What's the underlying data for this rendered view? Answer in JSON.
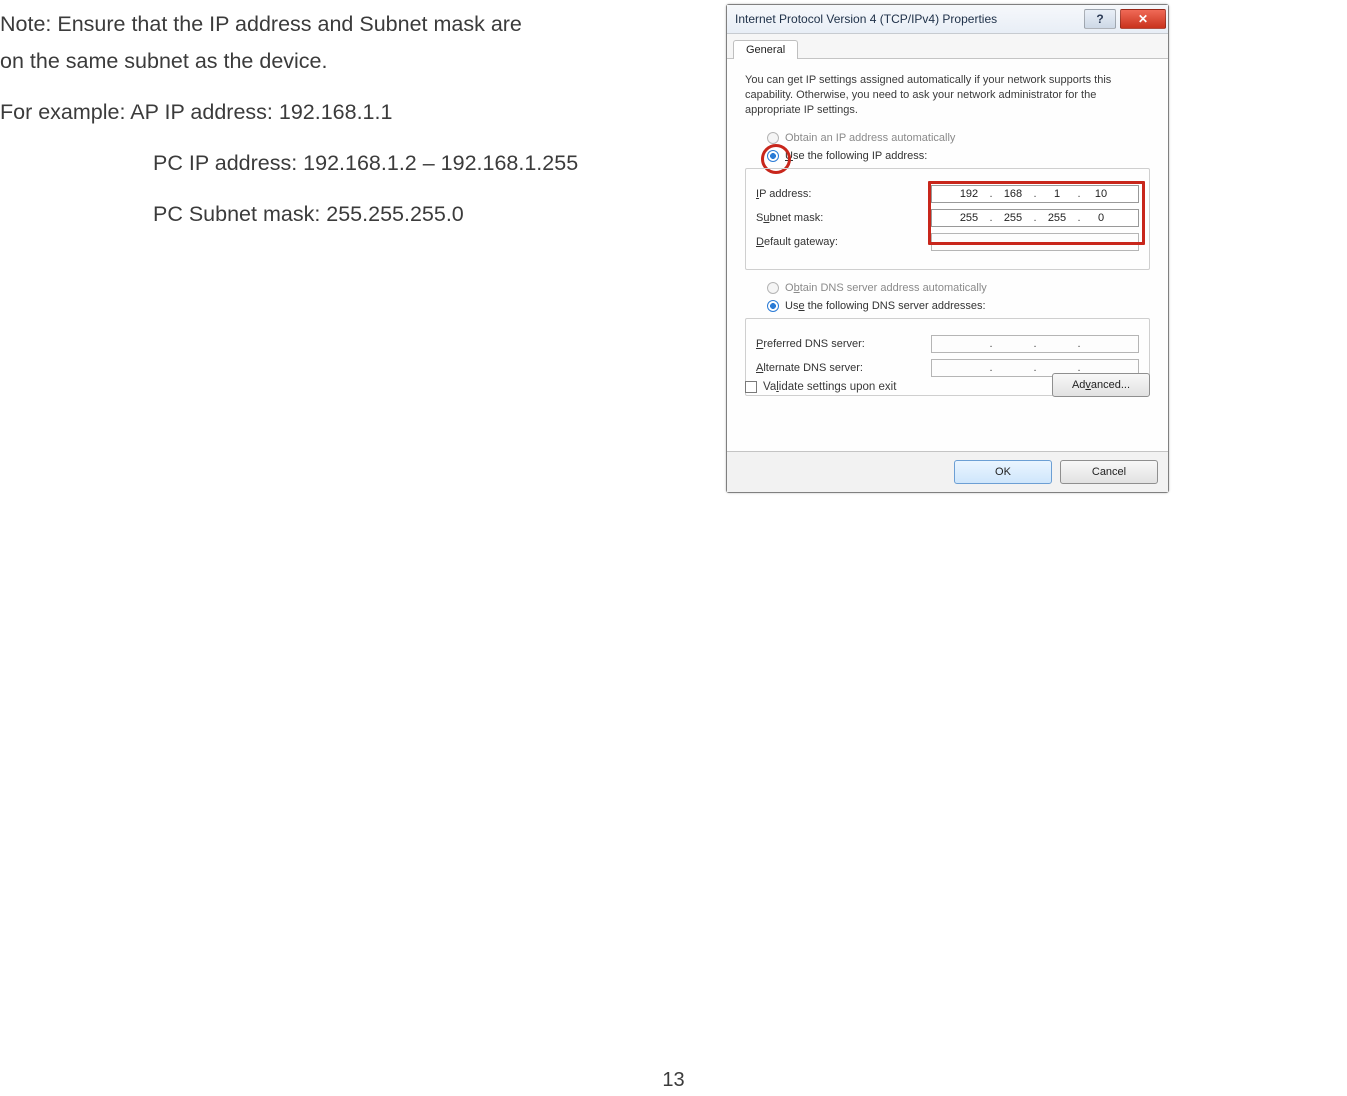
{
  "page_number": "13",
  "instructions": {
    "note_line1": "Note: Ensure that the IP address and Subnet mask are",
    "note_line2": "on the same subnet as the device.",
    "example_intro": "For example:",
    "ap_ip": "AP IP address: 192.168.1.1",
    "pc_ip": "PC IP address: 192.168.1.2 – 192.168.1.255",
    "pc_subnet": "PC Subnet mask: 255.255.255.0"
  },
  "dialog": {
    "title": "Internet Protocol Version 4 (TCP/IPv4) Properties",
    "help_glyph": "?",
    "close_glyph": "✕",
    "tab_general": "General",
    "description": "You can get IP settings assigned automatically if your network supports this capability. Otherwise, you need to ask your network administrator for the appropriate IP settings.",
    "radio_obtain_ip": "Obtain an IP address automatically",
    "radio_use_ip": "Use the following IP address:",
    "lbl_ip": "IP address:",
    "lbl_subnet": "Subnet mask:",
    "lbl_gateway": "Default gateway:",
    "ip": {
      "o1": "192",
      "o2": "168",
      "o3": "1",
      "o4": "10"
    },
    "subnet": {
      "o1": "255",
      "o2": "255",
      "o3": "255",
      "o4": "0"
    },
    "gateway": {
      "o1": "",
      "o2": "",
      "o3": "",
      "o4": ""
    },
    "radio_obtain_dns": "Obtain DNS server address automatically",
    "radio_use_dns": "Use the following DNS server addresses:",
    "lbl_pref_dns": "Preferred DNS server:",
    "lbl_alt_dns": "Alternate DNS server:",
    "pref_dns": {
      "o1": "",
      "o2": "",
      "o3": "",
      "o4": ""
    },
    "alt_dns": {
      "o1": "",
      "o2": "",
      "o3": "",
      "o4": ""
    },
    "validate_label": "Validate settings upon exit",
    "btn_advanced": "Advanced...",
    "btn_ok": "OK",
    "btn_cancel": "Cancel"
  }
}
